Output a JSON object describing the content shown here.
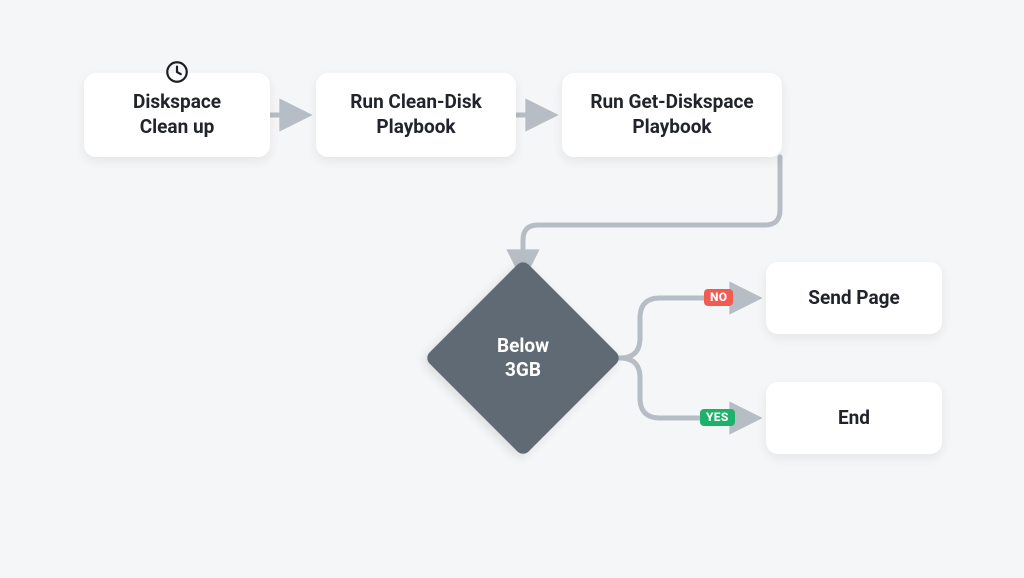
{
  "nodes": {
    "start": {
      "line1": "Diskspace",
      "line2": "Clean up"
    },
    "step1": {
      "line1": "Run Clean-Disk",
      "line2": "Playbook"
    },
    "step2": {
      "line1": "Run Get-Diskspace",
      "line2": "Playbook"
    },
    "decision": {
      "line1": "Below",
      "line2": "3GB"
    },
    "outNo": {
      "label": "Send Page"
    },
    "outYes": {
      "label": "End"
    }
  },
  "badges": {
    "no": "NO",
    "yes": "YES"
  },
  "colors": {
    "arrow": "#b6bdc4",
    "decisionFill": "#606a74",
    "badgeNo": "#f25b52",
    "badgeYes": "#1db26a"
  }
}
